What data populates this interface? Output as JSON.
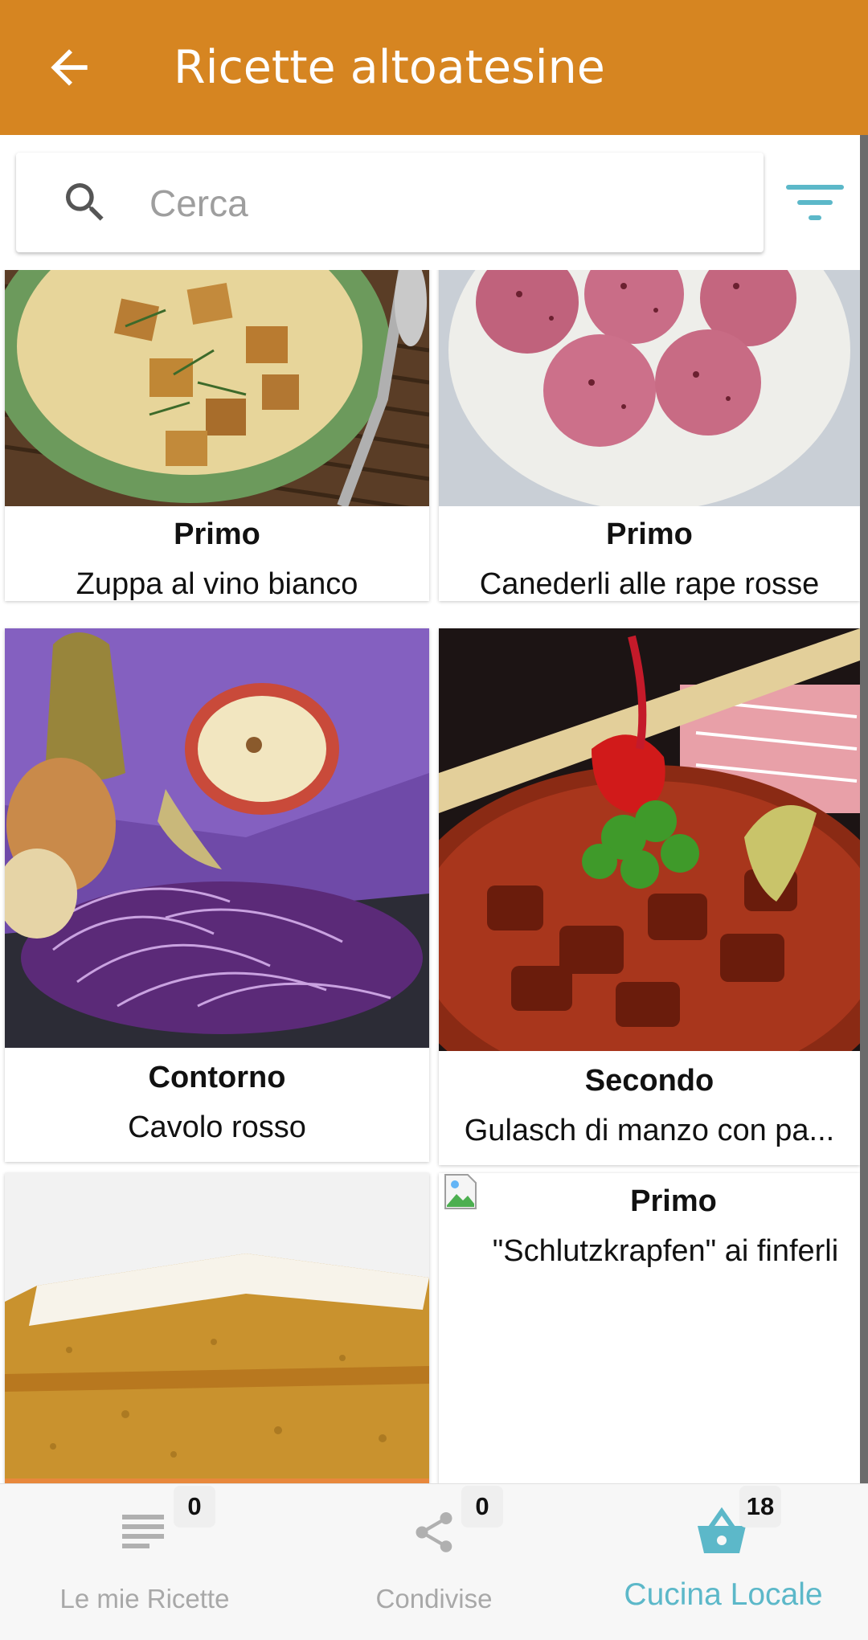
{
  "appbar": {
    "title": "Ricette altoatesine",
    "back_icon": "arrow-back-icon",
    "color": "#d68521"
  },
  "search": {
    "placeholder": "Cerca",
    "value": "",
    "icon": "search-icon",
    "filter_icon": "filter-icon"
  },
  "recipes": [
    {
      "category": "Primo",
      "name": "Zuppa al vino bianco"
    },
    {
      "category": "Primo",
      "name": "Canederli alle rape rosse"
    },
    {
      "category": "Contorno",
      "name": "Cavolo rosso"
    },
    {
      "category": "Secondo",
      "name": "Gulasch di manzo con pa..."
    },
    {
      "category": "",
      "name": ""
    },
    {
      "category": "Primo",
      "name": "\"Schlutzkrapfen\" ai finferli"
    }
  ],
  "bottom_nav": {
    "tabs": [
      {
        "label": "Le mie Ricette",
        "badge": "0",
        "icon": "list-icon"
      },
      {
        "label": "Condivise",
        "badge": "0",
        "icon": "share-icon"
      },
      {
        "label": "Cucina Locale",
        "badge": "18",
        "icon": "basket-icon"
      }
    ],
    "active_color": "#5cb8c9"
  }
}
